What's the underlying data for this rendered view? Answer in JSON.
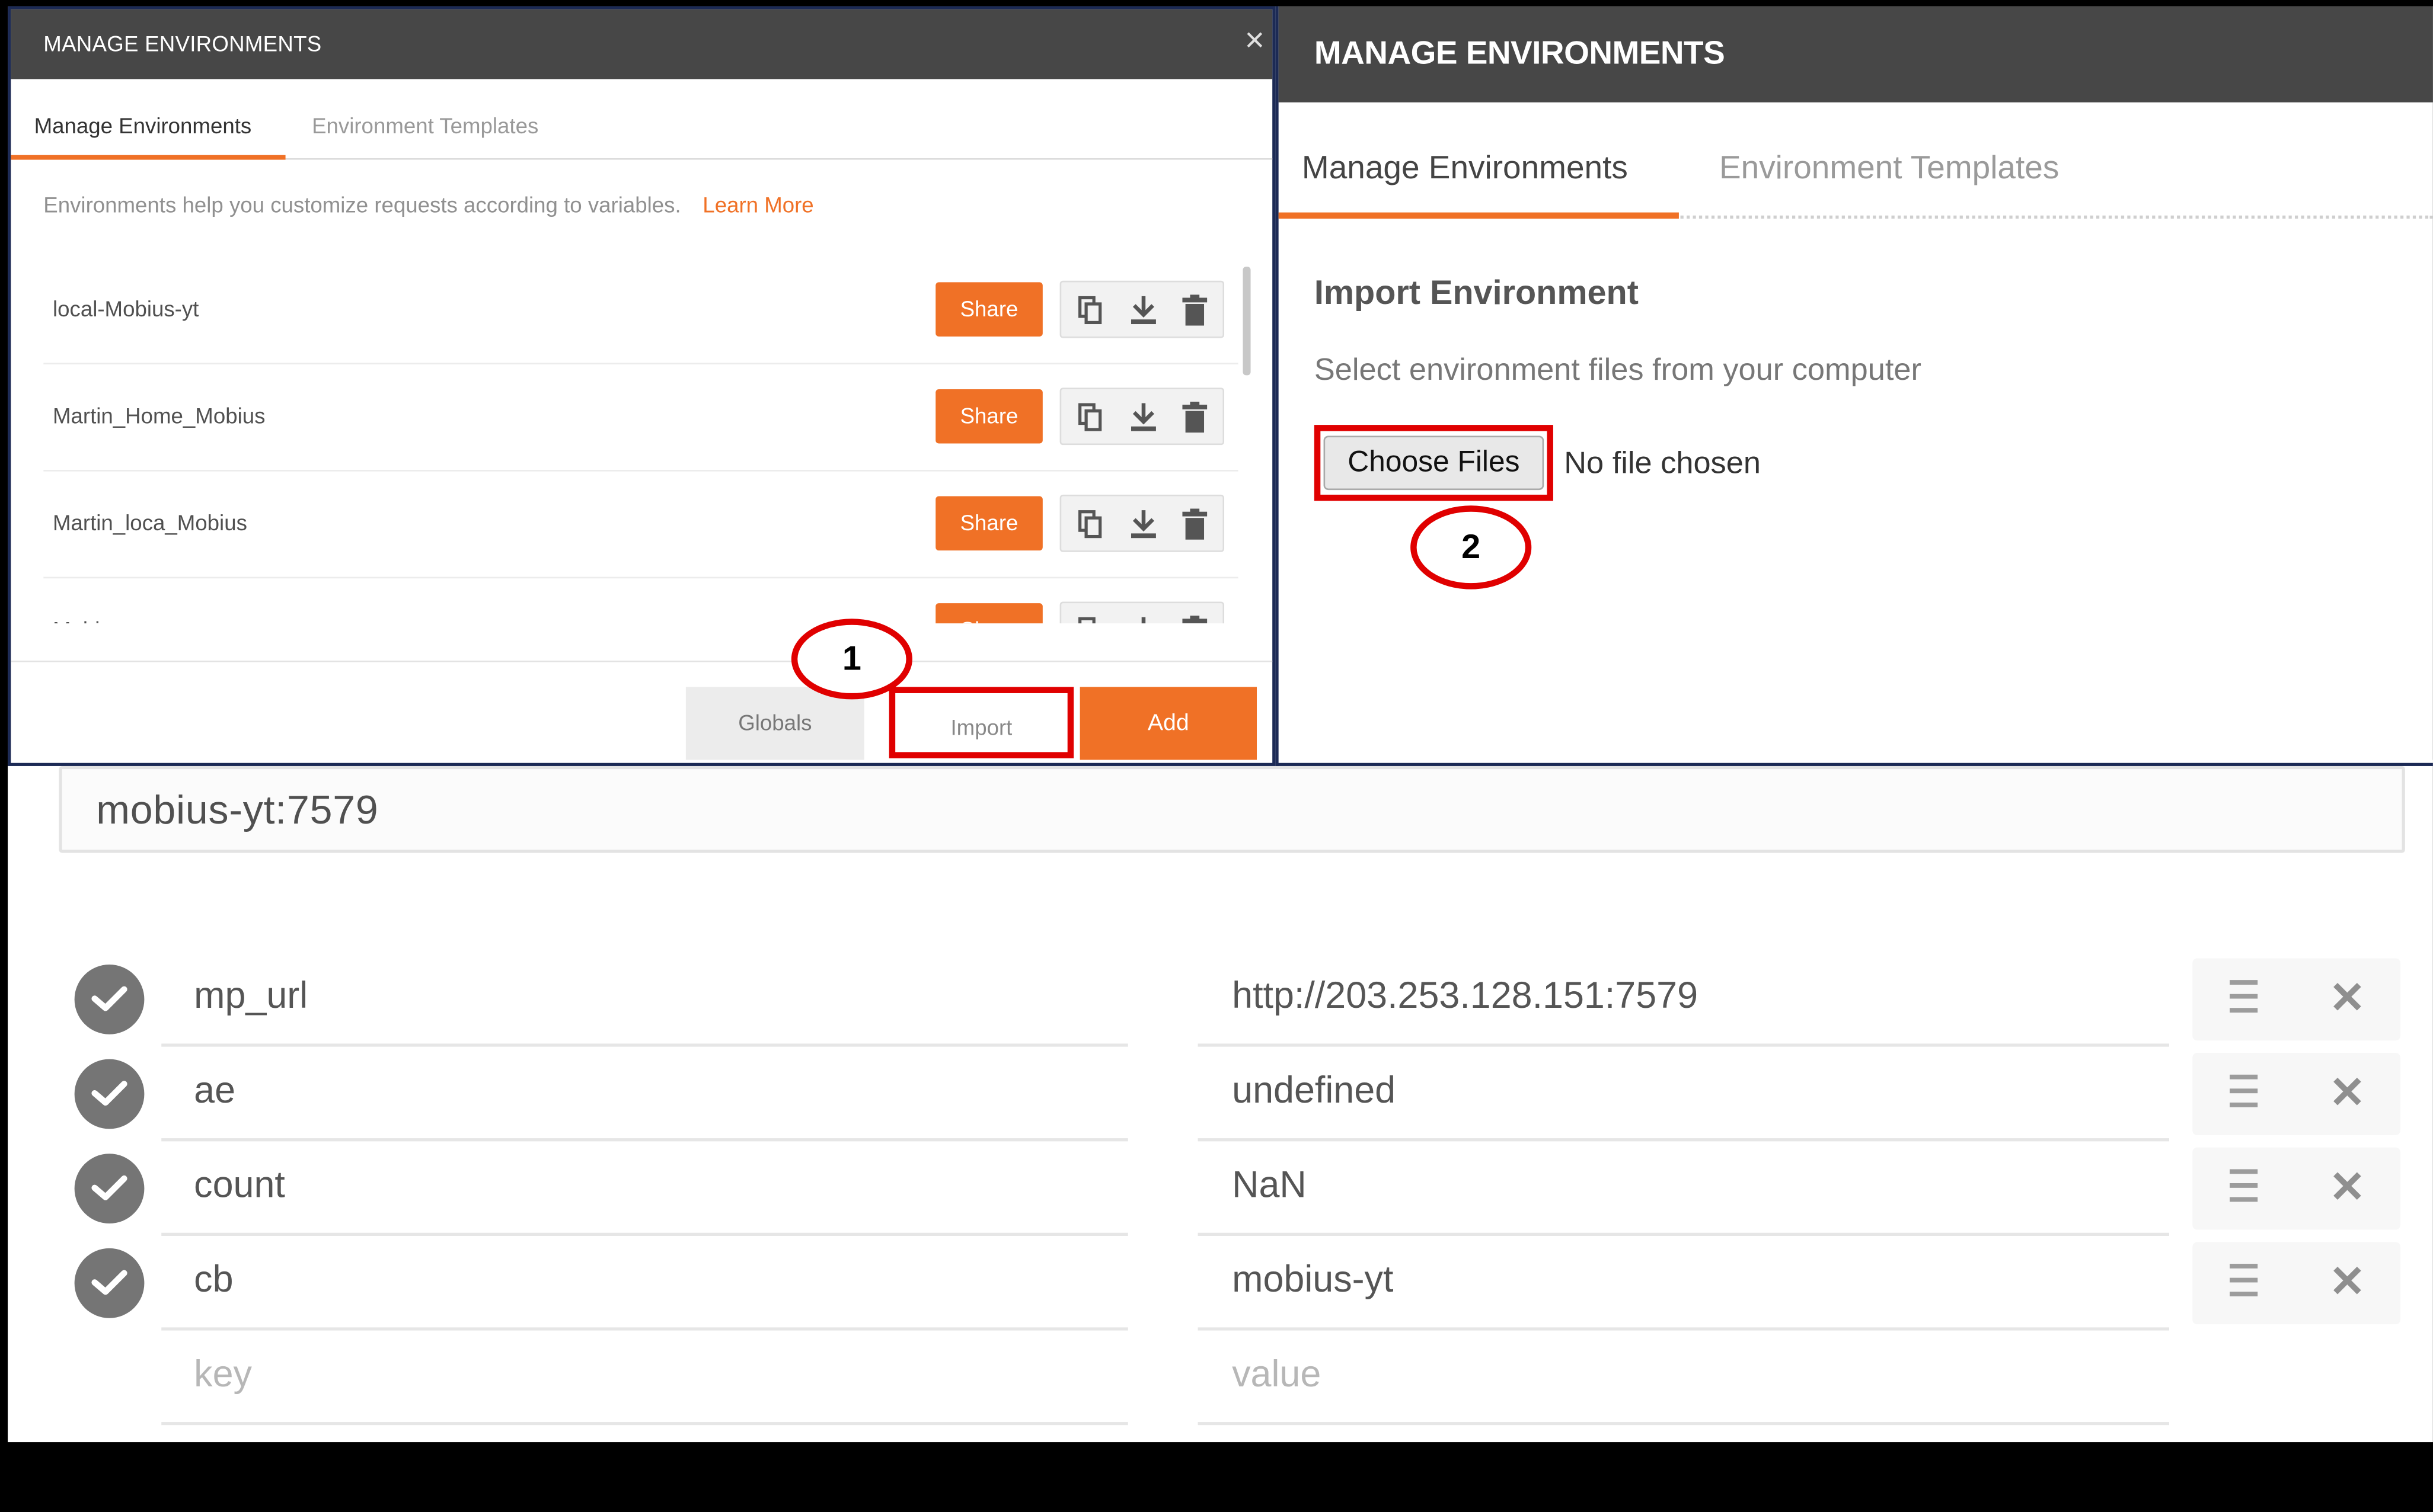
{
  "left_dialog": {
    "title": "MANAGE ENVIRONMENTS",
    "close_glyph": "×",
    "tabs": [
      "Manage Environments",
      "Environment Templates"
    ],
    "info_text": "Environments help you customize requests according to variables.",
    "learn_more": "Learn More",
    "environments": [
      {
        "name": "local-Mobius-yt",
        "share": "Share"
      },
      {
        "name": "Martin_Home_Mobius",
        "share": "Share"
      },
      {
        "name": "Martin_loca_Mobius",
        "share": "Share"
      },
      {
        "name": "Mobius",
        "share": "Share"
      }
    ],
    "buttons": {
      "globals": "Globals",
      "import": "Import",
      "add": "Add"
    },
    "callout": "1"
  },
  "right_dialog": {
    "title": "MANAGE ENVIRONMENTS",
    "tabs": [
      "Manage Environments",
      "Environment Templates"
    ],
    "import_title": "Import Environment",
    "import_subtitle": "Select environment files from your computer",
    "choose_files": "Choose Files",
    "no_file": "No file chosen",
    "callout": "2"
  },
  "editor": {
    "environment_name": "mobius-yt:7579",
    "variables": [
      {
        "key": "mp_url",
        "value": "http://203.253.128.151:7579"
      },
      {
        "key": "ae",
        "value": "undefined"
      },
      {
        "key": "count",
        "value": "NaN"
      },
      {
        "key": "cb",
        "value": "mobius-yt"
      }
    ],
    "key_placeholder": "key",
    "value_placeholder": "value",
    "delete_glyph": "✕"
  },
  "colors": {
    "accent": "#f07126",
    "header": "#474747",
    "highlight": "#e00000"
  }
}
